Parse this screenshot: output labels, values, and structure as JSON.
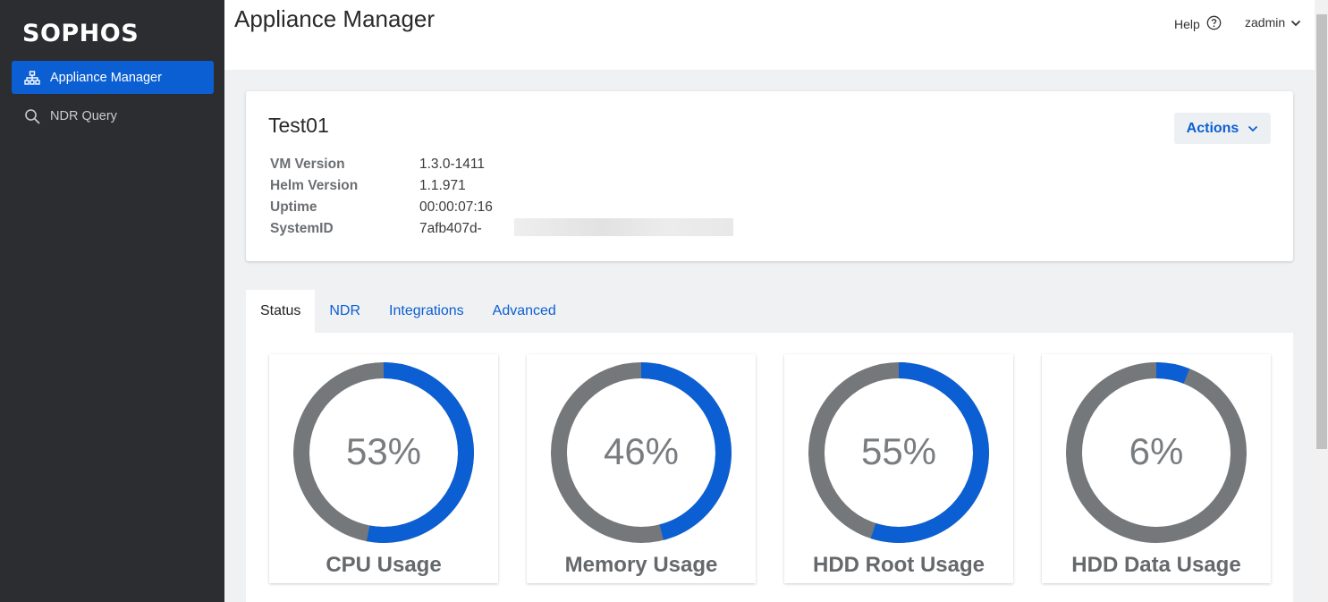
{
  "sidebar": {
    "logo": "SOPHOS",
    "items": [
      {
        "label": "Appliance Manager",
        "icon": "network-tree-icon",
        "active": true
      },
      {
        "label": "NDR Query",
        "icon": "search-icon",
        "active": false
      }
    ]
  },
  "header": {
    "title": "Appliance Manager",
    "help_label": "Help",
    "user_label": "zadmin"
  },
  "device": {
    "name": "Test01",
    "actions_label": "Actions",
    "info": [
      {
        "label": "VM Version",
        "value": "1.3.0-1411"
      },
      {
        "label": "Helm Version",
        "value": "1.1.971"
      },
      {
        "label": "Uptime",
        "value": "00:00:07:16"
      },
      {
        "label": "SystemID",
        "value": "7afb407d-"
      }
    ]
  },
  "tabs": [
    {
      "label": "Status",
      "active": true
    },
    {
      "label": "NDR",
      "active": false
    },
    {
      "label": "Integrations",
      "active": false
    },
    {
      "label": "Advanced",
      "active": false
    }
  ],
  "gauges": [
    {
      "label": "CPU Usage",
      "percent": 53,
      "display": "53%"
    },
    {
      "label": "Memory Usage",
      "percent": 46,
      "display": "46%"
    },
    {
      "label": "HDD Root Usage",
      "percent": 55,
      "display": "55%"
    },
    {
      "label": "HDD Data Usage",
      "percent": 6,
      "display": "6%"
    }
  ],
  "colors": {
    "accent": "#0b5fd3",
    "sidebar_bg": "#2b2d30",
    "gauge_used": "#0b5fd3",
    "gauge_free": "#75787b"
  }
}
